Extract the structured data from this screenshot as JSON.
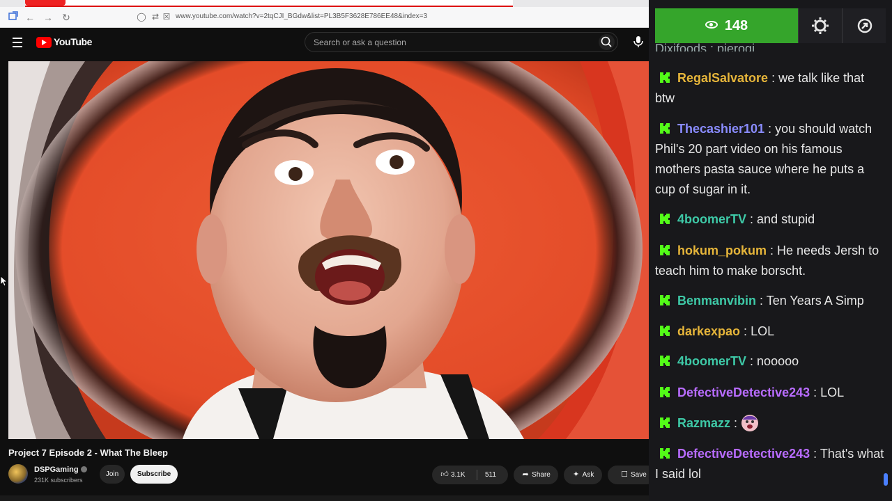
{
  "browser": {
    "url": "www.youtube.com/watch?v=2tqCJI_BGdw&list=PL3B5F3628E786EE48&index=3"
  },
  "header": {
    "logo_text": "YouTube",
    "search_placeholder": "Search or ask a question"
  },
  "video": {
    "title": "Project 7 Episode 2 - What The Bleep",
    "channel_name": "DSPGaming",
    "subscribers": "231K subscribers",
    "join_label": "Join",
    "subscribe_label": "Subscribe",
    "likes": "3.1K",
    "comments": "511",
    "share_label": "Share",
    "ask_label": "Ask",
    "save_label": "Save"
  },
  "chat": {
    "viewer_count": "148",
    "partial_top": "Dixifoods : pierogi",
    "messages": [
      {
        "user": "RegalSalvatore",
        "color": "#e6b53a",
        "text": "we talk like that btw"
      },
      {
        "user": "Thecashier101",
        "color": "#8a8cff",
        "text": "you should watch Phil's 20 part video on his famous mothers pasta sauce where he puts a cup of sugar in it."
      },
      {
        "user": "4boomerTV",
        "color": "#3ec9a7",
        "text": "and stupid"
      },
      {
        "user": "hokum_pokum",
        "color": "#e6b53a",
        "text": "He needs Jersh to teach him to make borscht."
      },
      {
        "user": "Benmanvibin",
        "color": "#3ec9a7",
        "text": "Ten Years A Simp"
      },
      {
        "user": "darkexpao",
        "color": "#e6b53a",
        "text": "LOL"
      },
      {
        "user": "4boomerTV",
        "color": "#3ec9a7",
        "text": "nooooo"
      },
      {
        "user": "DefectiveDetective243",
        "color": "#b86cff",
        "text": "LOL"
      },
      {
        "user": "Razmazz",
        "color": "#3ec9a7",
        "text": ""
      },
      {
        "user": "DefectiveDetective243",
        "color": "#b86cff",
        "text": "That's what I said lol"
      }
    ]
  },
  "colors": {
    "kick_green": "#53fc18",
    "viewer_green": "#35a52b",
    "yt_red": "#ff0000"
  }
}
